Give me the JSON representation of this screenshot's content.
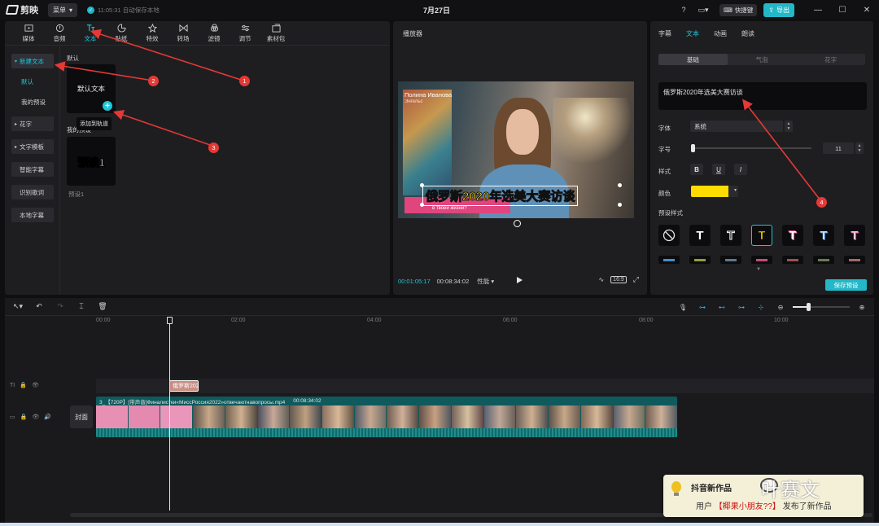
{
  "titlebar": {
    "app_name": "剪映",
    "menu_label": "菜单",
    "autosave": "11:05:31 自动保存本地",
    "window_title": "7月27日",
    "shortcut_label": "快捷键",
    "export_label": "导出"
  },
  "media_tabs": [
    {
      "label": "媒体",
      "icon": "media-icon"
    },
    {
      "label": "音频",
      "icon": "audio-icon"
    },
    {
      "label": "文本",
      "icon": "text-icon"
    },
    {
      "label": "贴纸",
      "icon": "sticker-icon"
    },
    {
      "label": "特效",
      "icon": "effects-icon"
    },
    {
      "label": "转场",
      "icon": "transition-icon"
    },
    {
      "label": "滤镜",
      "icon": "filter-icon"
    },
    {
      "label": "调节",
      "icon": "adjust-icon"
    },
    {
      "label": "素材包",
      "icon": "package-icon"
    }
  ],
  "text_sidebar": {
    "new_text": "新建文本",
    "default": "默认",
    "my_presets": "我的预设",
    "flower_text": "花字",
    "text_template": "文字模板",
    "smart_caption": "智能字幕",
    "recognize_lyrics": "识别歌词",
    "local_caption": "本地字幕"
  },
  "text_content": {
    "default_section": "默认",
    "default_tile": "默认文本",
    "add_tooltip": "添加到轨道",
    "my_presets_section": "我的预设",
    "preset_tile": "预设1",
    "preset_caption": "预设1"
  },
  "player": {
    "title": "播放器",
    "current_time": "00:01:05:17",
    "total_time": "00:08:34:02",
    "performance": "性能",
    "ratio": "16:9",
    "name_line1": "Полина Иванова",
    "name_line2": "Энгельс",
    "ru_caption": "в твоей жизни?",
    "cn_caption": "俄罗斯2020年选美大赛访谈"
  },
  "properties": {
    "tabs": [
      "字幕",
      "文本",
      "动画",
      "朗读"
    ],
    "active_tab": "文本",
    "segments": [
      "基础",
      "气泡",
      "花字"
    ],
    "text_value": "俄罗斯2020年选美大赛访谈",
    "font_label": "字体",
    "font_value": "系统",
    "size_label": "字号",
    "size_value": "11",
    "style_label": "样式",
    "color_label": "颜色",
    "color_value": "#ffdb00",
    "preset_style_label": "预设样式",
    "save_preset": "保存预设"
  },
  "timeline": {
    "ruler": [
      "00:00",
      "02:00",
      "04:00",
      "06:00",
      "08:00",
      "10:00"
    ],
    "text_clip": "俄罗斯2020年选美大赛访谈",
    "cover_label": "封面",
    "video_clip_name": "3_【720P】[带声音]Финалистки«МиссРоссия2022»отвечаютнавопросы.mp4",
    "video_clip_duration": "00:08:34:02"
  },
  "notification": {
    "title": "抖音新作品",
    "user_prefix": "用户",
    "user_name": "【椰果小朋友??】",
    "suffix": "发布了新作品"
  },
  "watermark": "叶赛文",
  "annotations": [
    "1",
    "2",
    "3",
    "4"
  ],
  "colors": {
    "accent": "#23c4d8",
    "annotation": "#e53935"
  }
}
